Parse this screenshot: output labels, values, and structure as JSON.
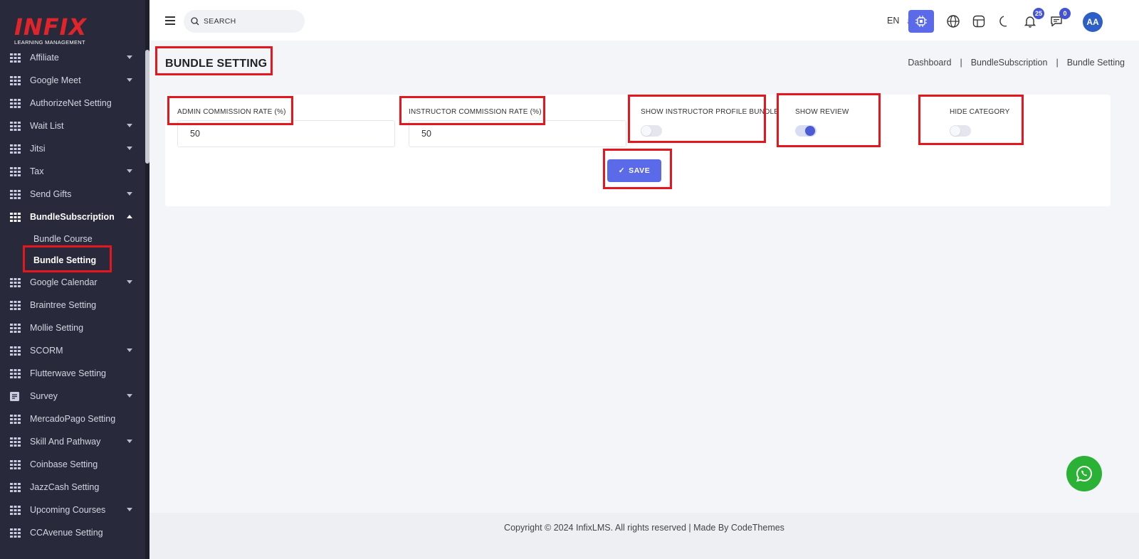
{
  "app": {
    "logo_word": "INFIX",
    "logo_sub": "LEARNING MANAGEMENT"
  },
  "sidebar": {
    "items": [
      {
        "label": "Affiliate",
        "icon": "grid-icon",
        "caret": true
      },
      {
        "label": "Google Meet",
        "icon": "grid-icon",
        "caret": true
      },
      {
        "label": "AuthorizeNet Setting",
        "icon": "grid-icon",
        "caret": false
      },
      {
        "label": "Wait List",
        "icon": "grid-icon",
        "caret": true
      },
      {
        "label": "Jitsi",
        "icon": "grid-icon",
        "caret": true
      },
      {
        "label": "Tax",
        "icon": "grid-icon",
        "caret": true
      },
      {
        "label": "Send Gifts",
        "icon": "grid-icon",
        "caret": true
      },
      {
        "label": "BundleSubscription",
        "icon": "grid-icon",
        "caret": true,
        "open": true
      },
      {
        "label": "Google Calendar",
        "icon": "grid-icon",
        "caret": true
      },
      {
        "label": "Braintree Setting",
        "icon": "grid-icon",
        "caret": false
      },
      {
        "label": "Mollie Setting",
        "icon": "grid-icon",
        "caret": false
      },
      {
        "label": "SCORM",
        "icon": "grid-icon",
        "caret": true
      },
      {
        "label": "Flutterwave Setting",
        "icon": "grid-icon",
        "caret": false
      },
      {
        "label": "Survey",
        "icon": "survey-icon",
        "caret": true
      },
      {
        "label": "MercadoPago Setting",
        "icon": "grid-icon",
        "caret": false
      },
      {
        "label": "Skill And Pathway",
        "icon": "grid-icon",
        "caret": true
      },
      {
        "label": "Coinbase Setting",
        "icon": "grid-icon",
        "caret": false
      },
      {
        "label": "JazzCash Setting",
        "icon": "grid-icon",
        "caret": false
      },
      {
        "label": "Upcoming Courses",
        "icon": "grid-icon",
        "caret": true
      },
      {
        "label": "CCAvenue Setting",
        "icon": "grid-icon",
        "caret": false
      }
    ],
    "submenu": [
      {
        "label": "Bundle Course",
        "active": false
      },
      {
        "label": "Bundle Setting",
        "active": true
      }
    ]
  },
  "header": {
    "search_placeholder": "SEARCH",
    "language": "EN",
    "notification_count": "25",
    "message_count": "0",
    "avatar_initials": "AA"
  },
  "page": {
    "title": "BUNDLE SETTING",
    "breadcrumb": [
      "Dashboard",
      "BundleSubscription",
      "Bundle Setting"
    ],
    "breadcrumb_separator": "|"
  },
  "form": {
    "admin_commission_label": "ADMIN COMMISSION RATE (%)",
    "admin_commission_value": "50",
    "instructor_commission_label": "INSTRUCTOR COMMISSION RATE (%)",
    "instructor_commission_value": "50",
    "show_instructor_profile_bundle_label": "SHOW INSTRUCTOR PROFILE BUNDLE",
    "show_instructor_profile_bundle": false,
    "show_review_label": "SHOW REVIEW",
    "show_review": true,
    "hide_category_label": "HIDE CATEGORY",
    "hide_category": false,
    "save_label": "SAVE"
  },
  "footer": {
    "text": "Copyright © 2024 InfixLMS. All rights reserved | Made By CodeThemes"
  },
  "colors": {
    "accent": "#5a6ae8",
    "sidebar_bg": "#28293a",
    "highlight_red": "#e5161d",
    "whatsapp_green": "#2bb135"
  }
}
